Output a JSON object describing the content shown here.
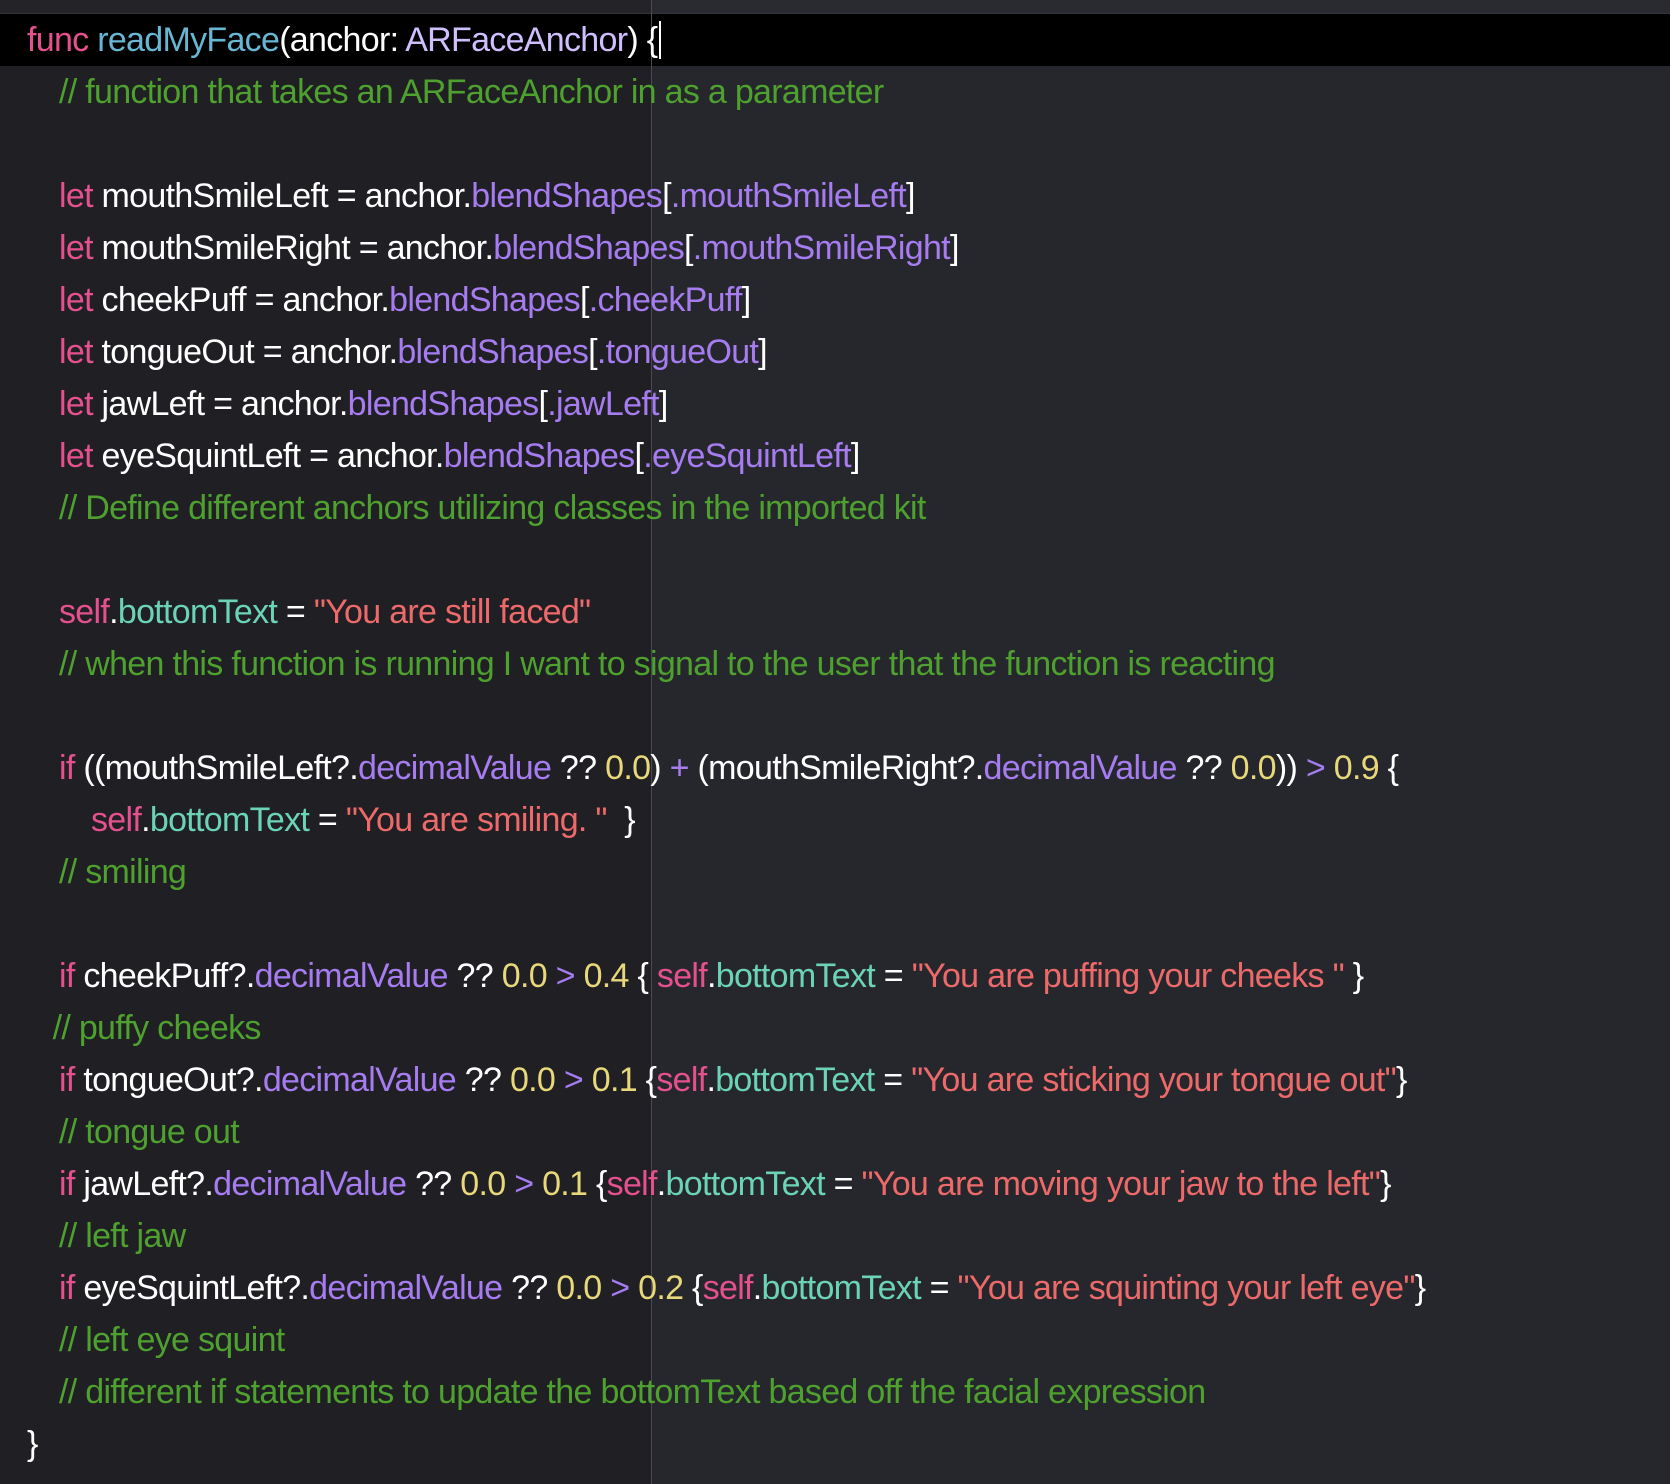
{
  "editor": {
    "theme_colors": {
      "background": "#26272c",
      "current_line": "#000000",
      "keyword": "#e5508f",
      "function_name": "#67b7d4",
      "type": "#d0bfff",
      "plain": "#ffffff",
      "comment": "#4ea12e",
      "member": "#a67cf0",
      "property": "#6bd3b6",
      "string": "#ee6a6a",
      "number": "#e8d87a"
    },
    "current_line_index": 0,
    "lines": [
      {
        "indent": 0,
        "tokens": [
          [
            "keyword",
            "func"
          ],
          [
            "plain",
            " "
          ],
          [
            "funcname",
            "readMyFace"
          ],
          [
            "plain",
            "(anchor: "
          ],
          [
            "type",
            "ARFaceAnchor"
          ],
          [
            "plain",
            ") {"
          ]
        ]
      },
      {
        "indent": 1,
        "tokens": [
          [
            "comment",
            "// function that takes an ARFaceAnchor in as a parameter"
          ]
        ]
      },
      {
        "indent": 1,
        "tokens": []
      },
      {
        "indent": 1,
        "tokens": [
          [
            "keyword",
            "let"
          ],
          [
            "plain",
            " mouthSmileLeft = anchor."
          ],
          [
            "member",
            "blendShapes"
          ],
          [
            "plain",
            "["
          ],
          [
            "member",
            ".mouthSmileLeft"
          ],
          [
            "plain",
            "]"
          ]
        ]
      },
      {
        "indent": 1,
        "tokens": [
          [
            "keyword",
            "let"
          ],
          [
            "plain",
            " mouthSmileRight = anchor."
          ],
          [
            "member",
            "blendShapes"
          ],
          [
            "plain",
            "["
          ],
          [
            "member",
            ".mouthSmileRight"
          ],
          [
            "plain",
            "]"
          ]
        ]
      },
      {
        "indent": 1,
        "tokens": [
          [
            "keyword",
            "let"
          ],
          [
            "plain",
            " cheekPuff = anchor."
          ],
          [
            "member",
            "blendShapes"
          ],
          [
            "plain",
            "["
          ],
          [
            "member",
            ".cheekPuff"
          ],
          [
            "plain",
            "]"
          ]
        ]
      },
      {
        "indent": 1,
        "tokens": [
          [
            "keyword",
            "let"
          ],
          [
            "plain",
            " tongueOut = anchor."
          ],
          [
            "member",
            "blendShapes"
          ],
          [
            "plain",
            "["
          ],
          [
            "member",
            ".tongueOut"
          ],
          [
            "plain",
            "]"
          ]
        ]
      },
      {
        "indent": 1,
        "tokens": [
          [
            "keyword",
            "let"
          ],
          [
            "plain",
            " jawLeft = anchor."
          ],
          [
            "member",
            "blendShapes"
          ],
          [
            "plain",
            "["
          ],
          [
            "member",
            ".jawLeft"
          ],
          [
            "plain",
            "]"
          ]
        ]
      },
      {
        "indent": 1,
        "tokens": [
          [
            "keyword",
            "let"
          ],
          [
            "plain",
            " eyeSquintLeft = anchor."
          ],
          [
            "member",
            "blendShapes"
          ],
          [
            "plain",
            "["
          ],
          [
            "member",
            ".eyeSquintLeft"
          ],
          [
            "plain",
            "]"
          ]
        ]
      },
      {
        "indent": 1,
        "tokens": [
          [
            "comment",
            "// Define different anchors utilizing classes in the imported kit"
          ]
        ]
      },
      {
        "indent": 1,
        "tokens": []
      },
      {
        "indent": 1,
        "tokens": [
          [
            "keyword",
            "self"
          ],
          [
            "plain",
            "."
          ],
          [
            "property",
            "bottomText"
          ],
          [
            "plain",
            " = "
          ],
          [
            "string",
            "\"You are still faced\""
          ]
        ]
      },
      {
        "indent": 1,
        "tokens": [
          [
            "comment",
            "// when this function is running I want to signal to the user that the function is reacting"
          ]
        ]
      },
      {
        "indent": 1,
        "tokens": []
      },
      {
        "indent": 1,
        "tokens": [
          [
            "keyword",
            "if"
          ],
          [
            "plain",
            " ((mouthSmileLeft?."
          ],
          [
            "member",
            "decimalValue"
          ],
          [
            "plain",
            " ?? "
          ],
          [
            "number",
            "0.0"
          ],
          [
            "plain",
            ") "
          ],
          [
            "operator",
            "+"
          ],
          [
            "plain",
            " (mouthSmileRight?."
          ],
          [
            "member",
            "decimalValue"
          ],
          [
            "plain",
            " ?? "
          ],
          [
            "number",
            "0.0"
          ],
          [
            "plain",
            "))"
          ],
          [
            "plain",
            " "
          ],
          [
            "operator",
            ">"
          ],
          [
            "plain",
            " "
          ],
          [
            "number",
            "0.9"
          ],
          [
            "plain",
            " {"
          ]
        ]
      },
      {
        "indent": 2,
        "tokens": [
          [
            "keyword",
            "self"
          ],
          [
            "plain",
            "."
          ],
          [
            "property",
            "bottomText"
          ],
          [
            "plain",
            " = "
          ],
          [
            "string",
            "\"You are smiling. \""
          ],
          [
            "plain",
            "  }"
          ]
        ]
      },
      {
        "indent": 1,
        "tokens": [
          [
            "comment",
            "// smiling"
          ]
        ]
      },
      {
        "indent": 1,
        "tokens": []
      },
      {
        "indent": 1,
        "tokens": [
          [
            "keyword",
            "if"
          ],
          [
            "plain",
            " cheekPuff?."
          ],
          [
            "member",
            "decimalValue"
          ],
          [
            "plain",
            " ?? "
          ],
          [
            "number",
            "0.0"
          ],
          [
            "plain",
            " "
          ],
          [
            "operator",
            ">"
          ],
          [
            "plain",
            " "
          ],
          [
            "number",
            "0.4"
          ],
          [
            "plain",
            " { "
          ],
          [
            "keyword",
            "self"
          ],
          [
            "plain",
            "."
          ],
          [
            "property",
            "bottomText"
          ],
          [
            "plain",
            " = "
          ],
          [
            "string",
            "\"You are puffing your cheeks \""
          ],
          [
            "plain",
            " }"
          ]
        ]
      },
      {
        "indent": 0.8,
        "tokens": [
          [
            "comment",
            "// puffy cheeks"
          ]
        ]
      },
      {
        "indent": 1,
        "tokens": [
          [
            "keyword",
            "if"
          ],
          [
            "plain",
            " tongueOut?."
          ],
          [
            "member",
            "decimalValue"
          ],
          [
            "plain",
            " ?? "
          ],
          [
            "number",
            "0.0"
          ],
          [
            "plain",
            " "
          ],
          [
            "operator",
            ">"
          ],
          [
            "plain",
            " "
          ],
          [
            "number",
            "0.1"
          ],
          [
            "plain",
            " {"
          ],
          [
            "keyword",
            "self"
          ],
          [
            "plain",
            "."
          ],
          [
            "property",
            "bottomText"
          ],
          [
            "plain",
            " = "
          ],
          [
            "string",
            "\"You are sticking your tongue out\""
          ],
          [
            "plain",
            "}"
          ]
        ]
      },
      {
        "indent": 1,
        "tokens": [
          [
            "comment",
            "// tongue out"
          ]
        ]
      },
      {
        "indent": 1,
        "tokens": [
          [
            "keyword",
            "if"
          ],
          [
            "plain",
            " jawLeft?."
          ],
          [
            "member",
            "decimalValue"
          ],
          [
            "plain",
            " ?? "
          ],
          [
            "number",
            "0.0"
          ],
          [
            "plain",
            " "
          ],
          [
            "operator",
            ">"
          ],
          [
            "plain",
            " "
          ],
          [
            "number",
            "0.1"
          ],
          [
            "plain",
            " {"
          ],
          [
            "keyword",
            "self"
          ],
          [
            "plain",
            "."
          ],
          [
            "property",
            "bottomText"
          ],
          [
            "plain",
            " = "
          ],
          [
            "string",
            "\"You are moving your jaw to the left\""
          ],
          [
            "plain",
            "}"
          ]
        ]
      },
      {
        "indent": 1,
        "tokens": [
          [
            "comment",
            "// left jaw"
          ]
        ]
      },
      {
        "indent": 1,
        "tokens": [
          [
            "keyword",
            "if"
          ],
          [
            "plain",
            " eyeSquintLeft?."
          ],
          [
            "member",
            "decimalValue"
          ],
          [
            "plain",
            " ?? "
          ],
          [
            "number",
            "0.0"
          ],
          [
            "plain",
            " "
          ],
          [
            "operator",
            ">"
          ],
          [
            "plain",
            " "
          ],
          [
            "number",
            "0.2"
          ],
          [
            "plain",
            " {"
          ],
          [
            "keyword",
            "self"
          ],
          [
            "plain",
            "."
          ],
          [
            "property",
            "bottomText"
          ],
          [
            "plain",
            " = "
          ],
          [
            "string",
            "\"You are squinting your left eye\""
          ],
          [
            "plain",
            "}"
          ]
        ]
      },
      {
        "indent": 1,
        "tokens": [
          [
            "comment",
            "// left eye squint"
          ]
        ]
      },
      {
        "indent": 1,
        "tokens": [
          [
            "comment",
            "// different if statements to update the bottomText based off the facial expression"
          ]
        ]
      },
      {
        "indent": 0,
        "tokens": [
          [
            "plain",
            "}"
          ]
        ]
      }
    ]
  }
}
